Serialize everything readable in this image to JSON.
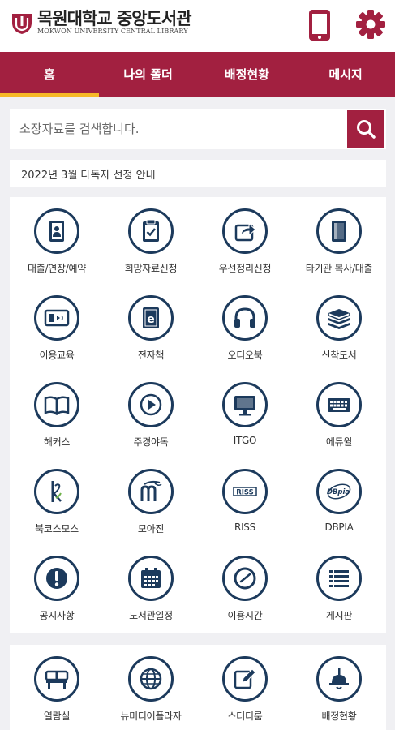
{
  "header": {
    "logo_title": "목원대학교 중앙도서관",
    "logo_subtitle": "MOKWON UNIVERSITY CENTRAL LIBRARY"
  },
  "tabs": [
    {
      "label": "홈",
      "active": true
    },
    {
      "label": "나의 폴더",
      "active": false
    },
    {
      "label": "배정현황",
      "active": false
    },
    {
      "label": "메시지",
      "active": false
    }
  ],
  "search": {
    "placeholder": "소장자료를 검색합니다."
  },
  "notice": {
    "text": "2022년 3월 다독자 선정 안내"
  },
  "menu": [
    {
      "label": "대출/연장/예약",
      "icon": "contact-book-icon"
    },
    {
      "label": "희망자료신청",
      "icon": "checklist-icon"
    },
    {
      "label": "우선정리신청",
      "icon": "share-arrow-icon"
    },
    {
      "label": "타기관 복사/대출",
      "icon": "book-icon"
    },
    {
      "label": "이용교육",
      "icon": "video-screen-icon"
    },
    {
      "label": "전자책",
      "icon": "ebook-icon"
    },
    {
      "label": "오디오북",
      "icon": "headphones-icon"
    },
    {
      "label": "신착도서",
      "icon": "book-stack-icon"
    },
    {
      "label": "해커스",
      "icon": "open-book-icon"
    },
    {
      "label": "주경야독",
      "icon": "play-icon"
    },
    {
      "label": "ITGO",
      "icon": "monitor-icon"
    },
    {
      "label": "에듀윌",
      "icon": "keyboard-icon"
    },
    {
      "label": "북코스모스",
      "icon": "bookcosmos-logo-icon"
    },
    {
      "label": "모아진",
      "icon": "moazine-logo-icon"
    },
    {
      "label": "RISS",
      "icon": "riss-logo-icon"
    },
    {
      "label": "DBPIA",
      "icon": "dbpia-logo-icon"
    },
    {
      "label": "공지사항",
      "icon": "exclamation-icon"
    },
    {
      "label": "도서관일정",
      "icon": "calendar-icon"
    },
    {
      "label": "이용시간",
      "icon": "clock-icon"
    },
    {
      "label": "게시판",
      "icon": "list-icon"
    }
  ],
  "bottom_menu": [
    {
      "label": "열람실",
      "icon": "reading-room-icon"
    },
    {
      "label": "뉴미디어플라자",
      "icon": "globe-icon"
    },
    {
      "label": "스터디룸",
      "icon": "edit-icon"
    },
    {
      "label": "배정현황",
      "icon": "lamp-icon"
    }
  ],
  "colors": {
    "brand": "#a22040",
    "tab_indicator": "#f6b928",
    "icon_navy": "#1c3a5c"
  }
}
